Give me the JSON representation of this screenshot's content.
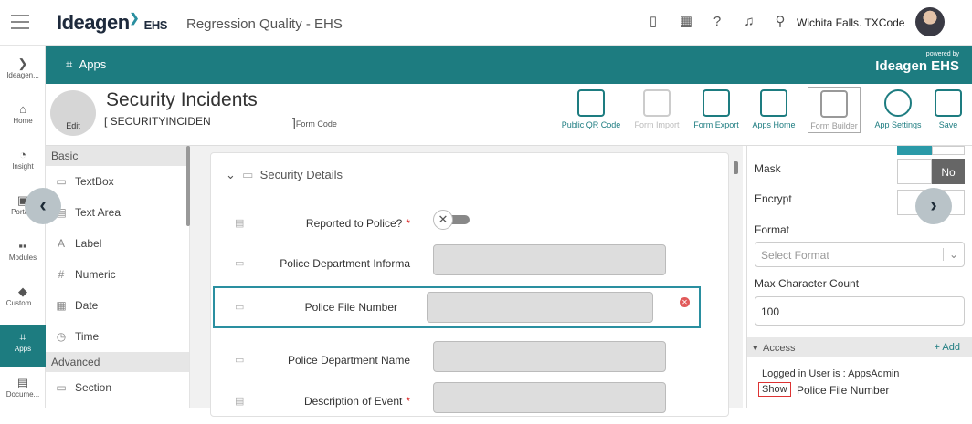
{
  "header": {
    "brand": "Ideagen",
    "brand_suffix": "EHS",
    "app_title": "Regression Quality - EHS",
    "location": "Wichita Falls. TXCode",
    "icons": [
      "mobile-icon",
      "calendar-icon",
      "help-icon",
      "bell-icon",
      "location-icon"
    ]
  },
  "leftnav": {
    "items": [
      {
        "label": "Ideagen...",
        "icon": "ideagen-icon"
      },
      {
        "label": "Home",
        "icon": "home-icon"
      },
      {
        "label": "Insight",
        "icon": "insight-icon"
      },
      {
        "label": "Porta...",
        "icon": "portal-icon"
      },
      {
        "label": "Modules",
        "icon": "modules-icon"
      },
      {
        "label": "Custom ...",
        "icon": "custom-icon"
      },
      {
        "label": "Apps",
        "icon": "apps-icon",
        "active": true
      },
      {
        "label": "Docume...",
        "icon": "document-icon"
      }
    ]
  },
  "appbar": {
    "apps_label": "Apps",
    "powered_by": "powered by",
    "powered_brand": "Ideagen EHS"
  },
  "form": {
    "edit_label": "Edit",
    "title": "Security Incidents",
    "code_value": "SECURITYINCIDEN",
    "code_label": "Form Code",
    "toolbar": [
      {
        "label": "Public QR Code",
        "icon": "qr-code-icon",
        "enabled": true
      },
      {
        "label": "Form Import",
        "icon": "form-import-icon",
        "enabled": false
      },
      {
        "label": "Form Export",
        "icon": "form-export-icon",
        "enabled": true
      },
      {
        "label": "Apps Home",
        "icon": "apps-home-icon",
        "enabled": true
      },
      {
        "label": "Form Builder",
        "icon": "form-builder-icon",
        "enabled": true,
        "selected": true
      },
      {
        "label": "App Settings",
        "icon": "settings-icon",
        "enabled": true
      },
      {
        "label": "Save",
        "icon": "save-icon",
        "enabled": true
      }
    ]
  },
  "palette": {
    "basic_label": "Basic",
    "basic": [
      {
        "label": "TextBox",
        "icon": "textbox-icon"
      },
      {
        "label": "Text Area",
        "icon": "textarea-icon"
      },
      {
        "label": "Label",
        "icon": "label-icon"
      },
      {
        "label": "Numeric",
        "icon": "numeric-icon"
      },
      {
        "label": "Date",
        "icon": "date-icon"
      },
      {
        "label": "Time",
        "icon": "time-icon"
      }
    ],
    "advanced_label": "Advanced",
    "advanced": [
      {
        "label": "Section",
        "icon": "section-icon"
      }
    ]
  },
  "canvas": {
    "section_title": "Security Details",
    "fields": [
      {
        "label": "Reported to Police?",
        "required": true,
        "type": "toggle"
      },
      {
        "label": "Police Department Informa",
        "required": false,
        "type": "text"
      },
      {
        "label": "Police File Number",
        "required": false,
        "type": "text",
        "selected": true
      },
      {
        "label": "Police Department Name",
        "required": false,
        "type": "text"
      },
      {
        "label": "Description of Event",
        "required": true,
        "type": "text"
      }
    ]
  },
  "properties": {
    "mask_label": "Mask",
    "mask_value": "No",
    "encrypt_label": "Encrypt",
    "format_label": "Format",
    "format_placeholder": "Select Format",
    "max_char_label": "Max Character Count",
    "max_char_value": "100",
    "access_label": "Access",
    "access_add": "+ Add",
    "logged_in_text": "Logged in User is : AppsAdmin",
    "show_label": "Show",
    "show_field": "Police File Number"
  },
  "colors": {
    "teal": "#1d7c80",
    "required": "#dd2222",
    "delete": "#e15a5a"
  }
}
